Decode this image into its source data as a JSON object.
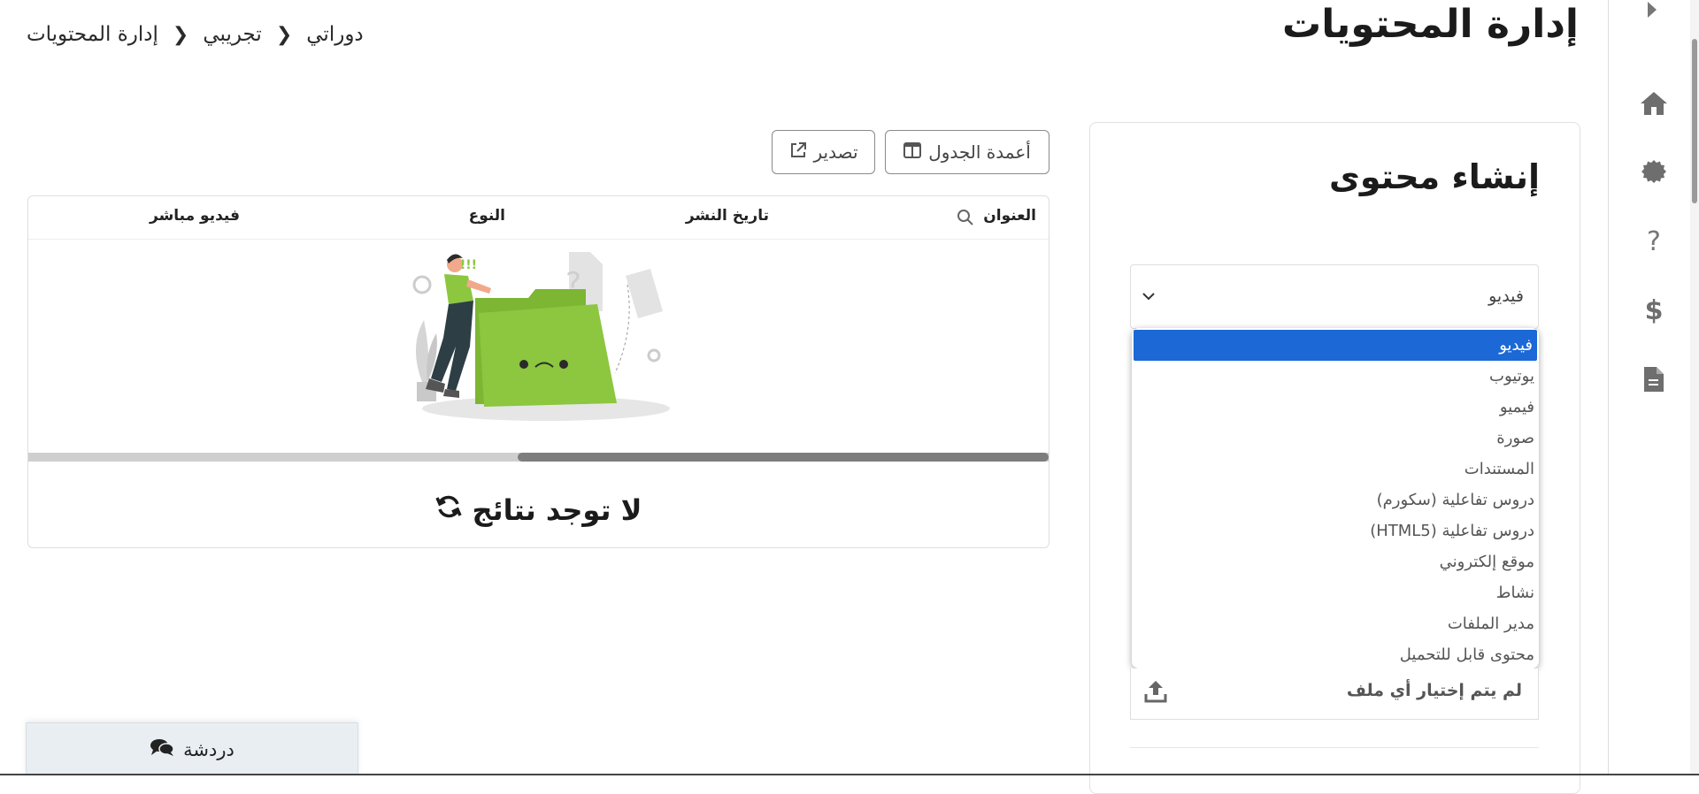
{
  "header": {
    "title": "إدارة المحتويات",
    "breadcrumb": [
      "دوراتي",
      "تجريبي",
      "إدارة المحتويات"
    ]
  },
  "toolbar": {
    "columns_label": "أعمدة الجدول",
    "export_label": "تصدير"
  },
  "table": {
    "columns": [
      "العنوان",
      "تاريخ النشر",
      "النوع",
      "فيديو مباشر"
    ],
    "empty_text": "لا توجد نتائج",
    "scroll_fraction": 0.52
  },
  "create_card": {
    "title": "إنشاء محتوى",
    "type_select": {
      "value": "فيديو",
      "options": [
        "فيديو",
        "يوتيوب",
        "فيميو",
        "صورة",
        "المستندات",
        "دروس تفاعلية (سكورم)",
        "دروس تفاعلية (HTML5)",
        "موقع إلكتروني",
        "نشاط",
        "مدير الملفات",
        "محتوى قابل للتحميل"
      ],
      "selected_index": 0
    },
    "file_input_text": "لم يتم إختيار أي ملف"
  },
  "chat": {
    "label": "دردشة"
  },
  "sidebar": {
    "icons": [
      "home-icon",
      "settings-icon",
      "help-icon",
      "dollar-icon",
      "file-icon"
    ]
  },
  "colors": {
    "accent": "#1b68d6",
    "folder_green": "#8dc63f"
  }
}
